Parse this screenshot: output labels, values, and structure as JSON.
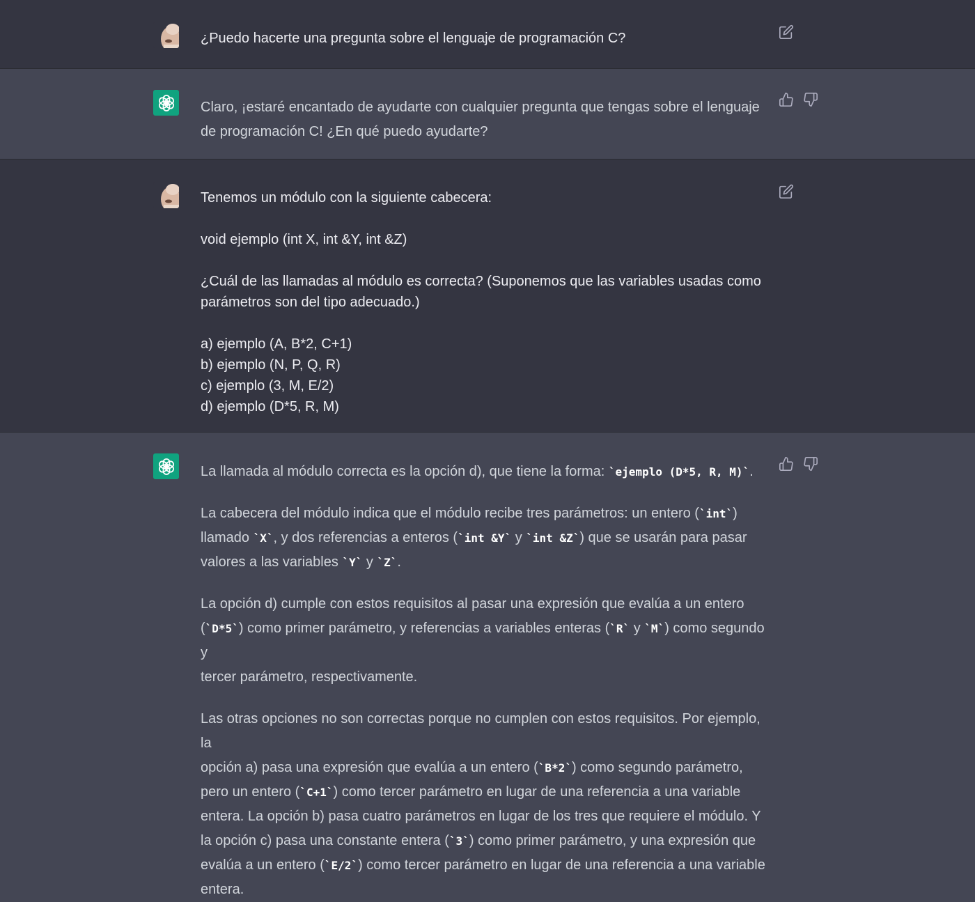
{
  "messages": {
    "m1": {
      "text": "¿Puedo hacerte una pregunta sobre el lenguaje de programación C?"
    },
    "m2": {
      "line1": "Claro, ¡estaré encantado de ayudarte con cualquier pregunta que tengas sobre el lenguaje",
      "line2": "de programación C! ¿En qué puedo ayudarte?"
    },
    "m3": {
      "intro": "Tenemos un módulo con la siguiente cabecera:",
      "signature": "void ejemplo (int X, int &Y, int &Z)",
      "question_l1": "¿Cuál de las llamadas al módulo es correcta? (Suponemos que las variables usadas como",
      "question_l2": "parámetros son del tipo adecuado.)",
      "options": [
        "a) ejemplo (A, B*2, C+1)",
        "b) ejemplo (N, P, Q, R)",
        "c) ejemplo (3, M, E/2)",
        "d) ejemplo (D*5, R, M)"
      ]
    },
    "m4": {
      "p1_text": "La llamada al módulo correcta es la opción d), que tiene la forma: ",
      "p1_code": "`ejemplo (D*5, R, M)`",
      "p1_end": ".",
      "p2": {
        "t1": "La cabecera del módulo indica que el módulo recibe tres parámetros: un entero (",
        "c1": "`int`",
        "t2": ")",
        "t3": "llamado ",
        "c2": "`X`",
        "t4": ", y dos referencias a enteros (",
        "c3": "`int &Y`",
        "t5": " y ",
        "c4": "`int &Z`",
        "t6": ") que se usarán para pasar",
        "t7": "valores a las variables ",
        "c5": "`Y`",
        "t8": " y ",
        "c6": "`Z`",
        "t9": "."
      },
      "p3": {
        "t1": "La opción d) cumple con estos requisitos al pasar una expresión que evalúa a un entero",
        "t2": "(",
        "c1": "`D*5`",
        "t3": ") como primer parámetro, y referencias a variables enteras (",
        "c2": "`R`",
        "t4": " y ",
        "c3": "`M`",
        "t5": ") como segundo y",
        "t6": "tercer parámetro, respectivamente."
      },
      "p4": {
        "t1": "Las otras opciones no son correctas porque no cumplen con estos requisitos. Por ejemplo, la",
        "t2": "opción a) pasa una expresión que evalúa a un entero (",
        "c1": "`B*2`",
        "t3": ") como segundo parámetro,",
        "t4": "pero un entero (",
        "c2": "`C+1`",
        "t5": ") como tercer parámetro en lugar de una referencia a una variable",
        "t6": "entera. La opción b) pasa cuatro parámetros en lugar de los tres que requiere el módulo. Y",
        "t7": "la opción c) pasa una constante entera (",
        "c3": "`3`",
        "t8": ") como primer parámetro, y una expresión que",
        "t9": "evalúa a un entero (",
        "c4": "`E/2`",
        "t10": ") como tercer parámetro en lugar de una referencia a una variable",
        "t11": "entera."
      }
    }
  },
  "icons": {
    "edit": "edit-icon",
    "thumbs_up": "thumbs-up-icon",
    "thumbs_down": "thumbs-down-icon",
    "assistant_logo": "openai-logo-icon",
    "user_avatar": "user-avatar"
  },
  "colors": {
    "user_bg": "#343541",
    "assistant_bg": "#444654",
    "logo_bg": "#10a37f"
  }
}
